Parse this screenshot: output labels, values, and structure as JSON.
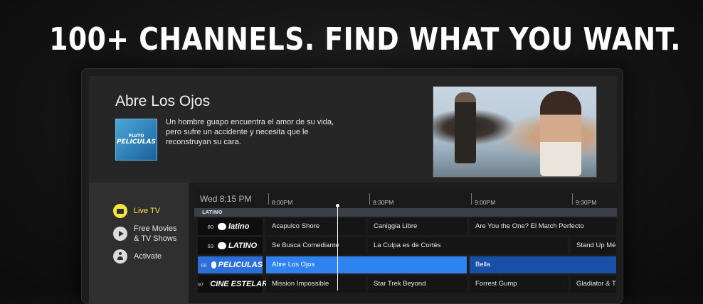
{
  "headline": "100+ CHANNELS. FIND WHAT YOU WANT.",
  "program": {
    "title": "Abre Los Ojos",
    "thumb_top": "PLUTO",
    "thumb_name": "PELICULAS",
    "description": "Un hombre guapo encuentra el amor de su vida, pero sufre un accidente y necesita que le reconstruyan su cara."
  },
  "nav": {
    "live_tv": "Live TV",
    "movies": "Free Movies & TV Shows",
    "activate": "Activate"
  },
  "guide": {
    "now": "Wed 8:15 PM",
    "times": [
      "8:00PM",
      "8:30PM",
      "9:00PM",
      "9:30PM"
    ],
    "category": "LATINO",
    "rows": [
      {
        "num": "80",
        "name": "latino",
        "cells": [
          "Acapulco Shore",
          "Caniggia Libre",
          "Are You the One? El Match Perfecto"
        ]
      },
      {
        "num": "93",
        "name": "LATINO",
        "cells": [
          "Se Busca Comediante",
          "La Culpa es de Cortés",
          "Stand Up Mé"
        ]
      },
      {
        "num": "86",
        "name": "PELICULAS",
        "cells": [
          "Abre Los Ojos",
          "Bella"
        ]
      },
      {
        "num": "97",
        "name": "CINE ESTELAR",
        "cells": [
          "Mission Impossible",
          "Star Trek Beyond",
          "Forrest Gump",
          "Gladiator & T"
        ]
      }
    ]
  },
  "colors": {
    "accent_yellow": "#f5e63c",
    "selected_blue": "#2f83f0",
    "selected_row_blue": "#1a4fa8"
  }
}
